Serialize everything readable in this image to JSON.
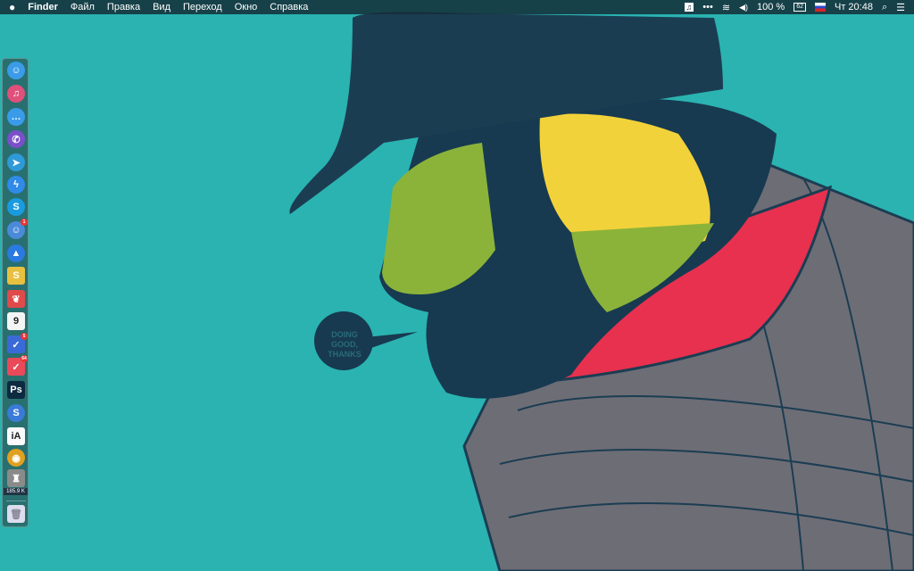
{
  "menubar": {
    "apple": "",
    "app": "Finder",
    "items": [
      "Файл",
      "Правка",
      "Вид",
      "Переход",
      "Окно",
      "Справка"
    ],
    "status": {
      "music": "♫",
      "more": "•••",
      "wifi": "wifi",
      "volume": "◀)",
      "battery_pct": "100 %",
      "battery_icon": "62",
      "clock": "Чт 20:48",
      "search": "⌕",
      "list": "☰"
    }
  },
  "dock": {
    "items": [
      {
        "name": "finder",
        "g": "☺",
        "c": "#3a9be8"
      },
      {
        "name": "itunes",
        "g": "♫",
        "c": "#e0507a"
      },
      {
        "name": "messages",
        "g": "…",
        "c": "#3a9be8"
      },
      {
        "name": "viber",
        "g": "✆",
        "c": "#7a4fc9"
      },
      {
        "name": "telegram",
        "g": "➤",
        "c": "#2f9ad8"
      },
      {
        "name": "messenger",
        "g": "ϟ",
        "c": "#2f8ae8"
      },
      {
        "name": "skype",
        "g": "S",
        "c": "#1a9be0"
      },
      {
        "name": "chat",
        "g": "☺",
        "c": "#4a8ad8",
        "badge": "1"
      },
      {
        "name": "spark",
        "g": "▲",
        "c": "#2a7ae0"
      },
      {
        "name": "slack",
        "g": "S",
        "c": "#e8c040",
        "sq": true
      },
      {
        "name": "leaf",
        "g": "❦",
        "c": "#e04a4a",
        "sq": true
      },
      {
        "name": "calendar",
        "g": "9",
        "c": "#f4f4f4",
        "sq": true,
        "dark": true
      },
      {
        "name": "tasks",
        "g": "✓",
        "c": "#3a6ad8",
        "sq": true,
        "badge": "5"
      },
      {
        "name": "pocket",
        "g": "✓",
        "c": "#e84a5a",
        "sq": true,
        "badge": "64"
      },
      {
        "name": "photoshop",
        "g": "Ps",
        "c": "#0c2a40",
        "sq": true
      },
      {
        "name": "simplenote",
        "g": "S",
        "c": "#3a7ad8"
      },
      {
        "name": "ia-writer",
        "g": "iA",
        "c": "#fafafa",
        "sq": true,
        "dark": true
      },
      {
        "name": "chrome",
        "g": "◉",
        "c": "#e0a020"
      },
      {
        "name": "monitor",
        "g": "♜",
        "c": "#8a8a8a",
        "sq": true
      }
    ],
    "monitor_label": "185.9 K",
    "trash": "trash"
  },
  "wallpaper": {
    "speech_bubble": [
      "DOING",
      "GOOD,",
      "THANKS"
    ]
  },
  "colors": {
    "bg": "#2ab3b1",
    "hat": "#1b3d52",
    "face": "#8bb33a",
    "hood": "#6d6d76",
    "collar": "#e8304f"
  }
}
